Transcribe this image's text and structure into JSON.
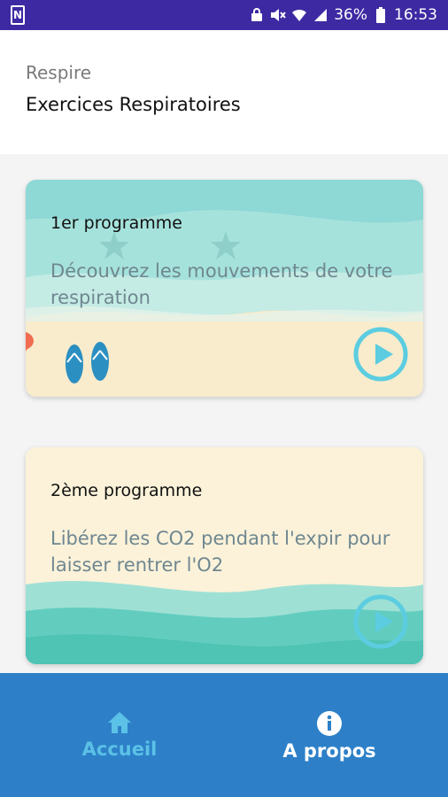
{
  "status_bar": {
    "battery_percent": "36%",
    "time": "16:53",
    "icons": [
      "n-icon",
      "lock-icon",
      "mute-icon",
      "wifi-icon",
      "signal-icon",
      "battery-icon"
    ]
  },
  "header": {
    "app_name": "Respire",
    "page_title": "Exercices Respiratoires"
  },
  "programs": [
    {
      "title": "1er programme",
      "description": "Découvrez les mouvements de votre respiration"
    },
    {
      "title": "2ème programme",
      "description": "Libérez les CO2 pendant l'expir pour laisser rentrer l'O2"
    }
  ],
  "bottom_nav": {
    "home_label": "Accueil",
    "about_label": "A propos"
  },
  "colors": {
    "status_bar": "#3d2aa3",
    "nav_bar": "#2d80c8",
    "nav_active": "#5bc1e6",
    "play_button": "#5ccde0"
  }
}
